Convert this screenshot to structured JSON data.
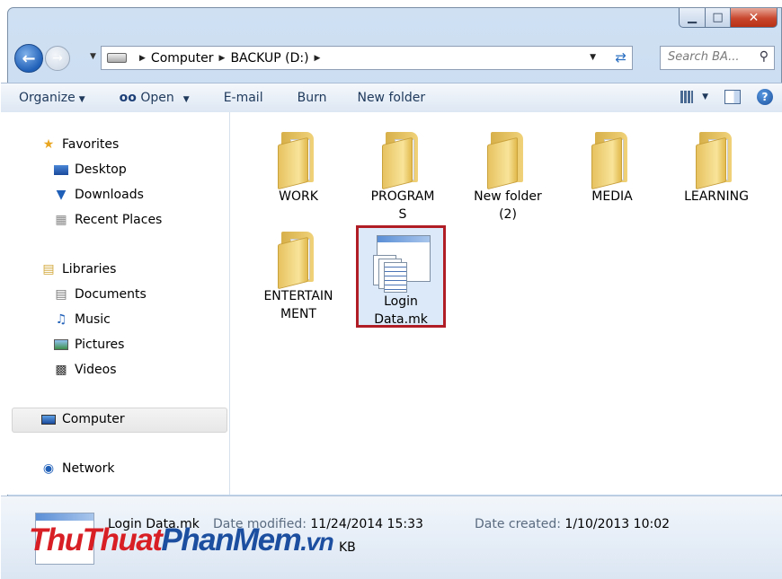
{
  "window": {
    "controls": {
      "minimize": "▁",
      "maximize": "□",
      "close": "✕"
    }
  },
  "address_bar": {
    "breadcrumbs": [
      "Computer",
      "BACKUP (D:)"
    ],
    "search_placeholder": "Search BA...",
    "icons": {
      "back": "back-arrow-icon",
      "forward": "forward-arrow-icon",
      "drive": "drive-icon",
      "refresh": "refresh-icon",
      "search": "search-icon"
    }
  },
  "toolbar": {
    "organize": "Organize",
    "open": "Open",
    "email": "E-mail",
    "burn": "Burn",
    "new_folder": "New folder"
  },
  "sidebar": {
    "favorites": "Favorites",
    "desktop": "Desktop",
    "downloads": "Downloads",
    "recent_places": "Recent Places",
    "libraries": "Libraries",
    "documents": "Documents",
    "music": "Music",
    "pictures": "Pictures",
    "videos": "Videos",
    "computer": "Computer",
    "network": "Network"
  },
  "files": {
    "work": "WORK",
    "programs_1": "PROGRAM",
    "programs_2": "S",
    "new_folder_1": "New folder",
    "new_folder_2": "(2)",
    "media": "MEDIA",
    "learning": "LEARNING",
    "entertainment_1": "ENTERTAIN",
    "entertainment_2": "MENT",
    "login_1": "Login",
    "login_2": "Data.mk"
  },
  "selected_file": "Login Data.mk",
  "status": {
    "name": "Login Data.mk",
    "date_modified_label": "Date modified:",
    "date_modified": "11/24/2014 15:33",
    "date_created_label": "Date created:",
    "date_created": "1/10/2013 10:02",
    "size_unit": "KB"
  },
  "watermark": {
    "part1": "ThuThuat",
    "part2": "PhanMem",
    "part3": ".vn"
  },
  "colors": {
    "selection_border": "#b11d24",
    "selection_fill": "#dbe9f8",
    "accent": "#1d4fa0"
  }
}
